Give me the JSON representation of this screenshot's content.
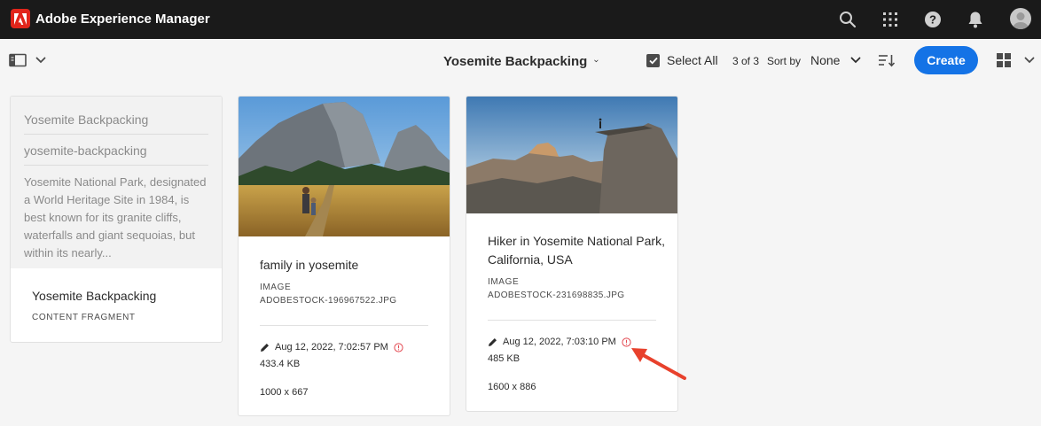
{
  "shell": {
    "app_title": "Adobe Experience Manager",
    "icons": [
      "search-icon",
      "solutions-grid-icon",
      "help-icon",
      "bell-icon",
      "user-avatar"
    ]
  },
  "actionbar": {
    "folder_title": "Yosemite Backpacking",
    "select_all": "Select All",
    "count": "3 of 3",
    "sort_label": "Sort by",
    "sort_value": "None",
    "create": "Create"
  },
  "cards": {
    "fragment": {
      "preview_title": "Yosemite Backpacking",
      "preview_name": "yosemite-backpacking",
      "preview_desc": "Yosemite National Park, designated a World Heritage Site in 1984, is best known for its granite cliffs, waterfalls and giant sequoias, but within its nearly...",
      "title": "Yosemite Backpacking",
      "type": "CONTENT FRAGMENT"
    },
    "family": {
      "title": "family in yosemite",
      "type": "IMAGE",
      "filename": "ADOBESTOCK-196967522.JPG",
      "modified": "Aug 12, 2022, 7:02:57 PM",
      "size": "433.4 KB",
      "dimensions": "1000 x 667"
    },
    "hiker": {
      "title": "Hiker in Yosemite National Park, California, USA",
      "type": "IMAGE",
      "filename": "ADOBESTOCK-231698835.JPG",
      "modified": "Aug 12, 2022, 7:03:10 PM",
      "size": "485 KB",
      "dimensions": "1600 x 886"
    }
  },
  "colors": {
    "shell_bg": "#1a1a1a",
    "accent": "#1473e6",
    "adobe_red": "#e1251b",
    "warning": "#e34850",
    "annotation_arrow": "#e8412c"
  }
}
